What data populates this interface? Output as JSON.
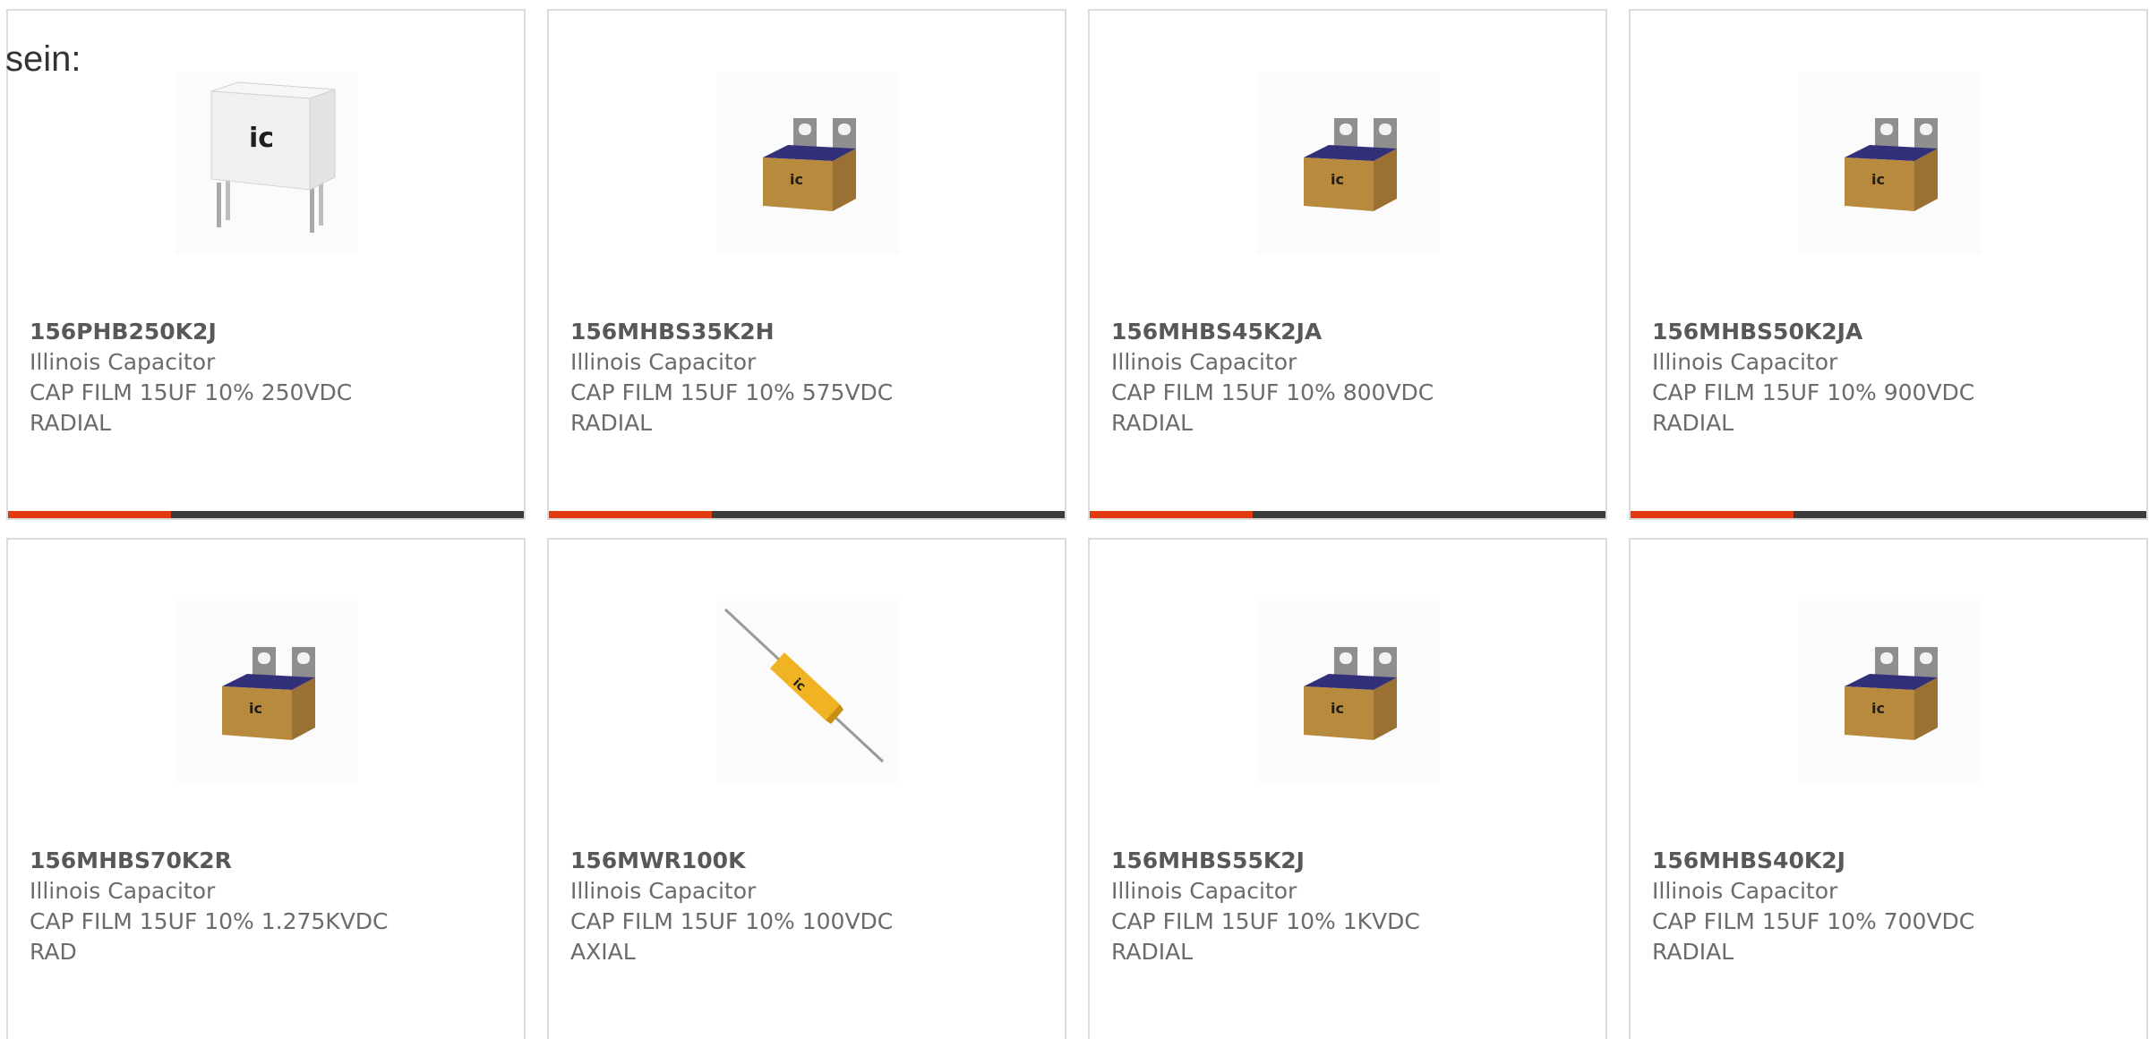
{
  "intro_text": "sein:",
  "colors": {
    "accent": "#e03a0e",
    "bar": "#3b3b3b",
    "border": "#dcdcdc",
    "text": "#6b6b6b"
  },
  "products": [
    {
      "part_number": "156PHB250K2J",
      "manufacturer": "Illinois Capacitor",
      "description": "CAP FILM 15UF 10% 250VDC RADIAL",
      "image": "white-box-capacitor-image"
    },
    {
      "part_number": "156MHBS35K2H",
      "manufacturer": "Illinois Capacitor",
      "description": "CAP FILM 15UF 10% 575VDC RADIAL",
      "image": "box-capacitor-tabs-image"
    },
    {
      "part_number": "156MHBS45K2JA",
      "manufacturer": "Illinois Capacitor",
      "description": "CAP FILM 15UF 10% 800VDC RADIAL",
      "image": "box-capacitor-tabs-image"
    },
    {
      "part_number": "156MHBS50K2JA",
      "manufacturer": "Illinois Capacitor",
      "description": "CAP FILM 15UF 10% 900VDC RADIAL",
      "image": "box-capacitor-tabs-image"
    },
    {
      "part_number": "156MHBS70K2R",
      "manufacturer": "Illinois Capacitor",
      "description": "CAP FILM 15UF 10% 1.275KVDC RAD",
      "image": "box-capacitor-tabs-image"
    },
    {
      "part_number": "156MWR100K",
      "manufacturer": "Illinois Capacitor",
      "description": "CAP FILM 15UF 10% 100VDC AXIAL",
      "image": "axial-capacitor-image"
    },
    {
      "part_number": "156MHBS55K2J",
      "manufacturer": "Illinois Capacitor",
      "description": "CAP FILM 15UF 10% 1KVDC RADIAL",
      "image": "box-capacitor-tabs-image"
    },
    {
      "part_number": "156MHBS40K2J",
      "manufacturer": "Illinois Capacitor",
      "description": "CAP FILM 15UF 10% 700VDC RADIAL",
      "image": "box-capacitor-tabs-image"
    }
  ]
}
